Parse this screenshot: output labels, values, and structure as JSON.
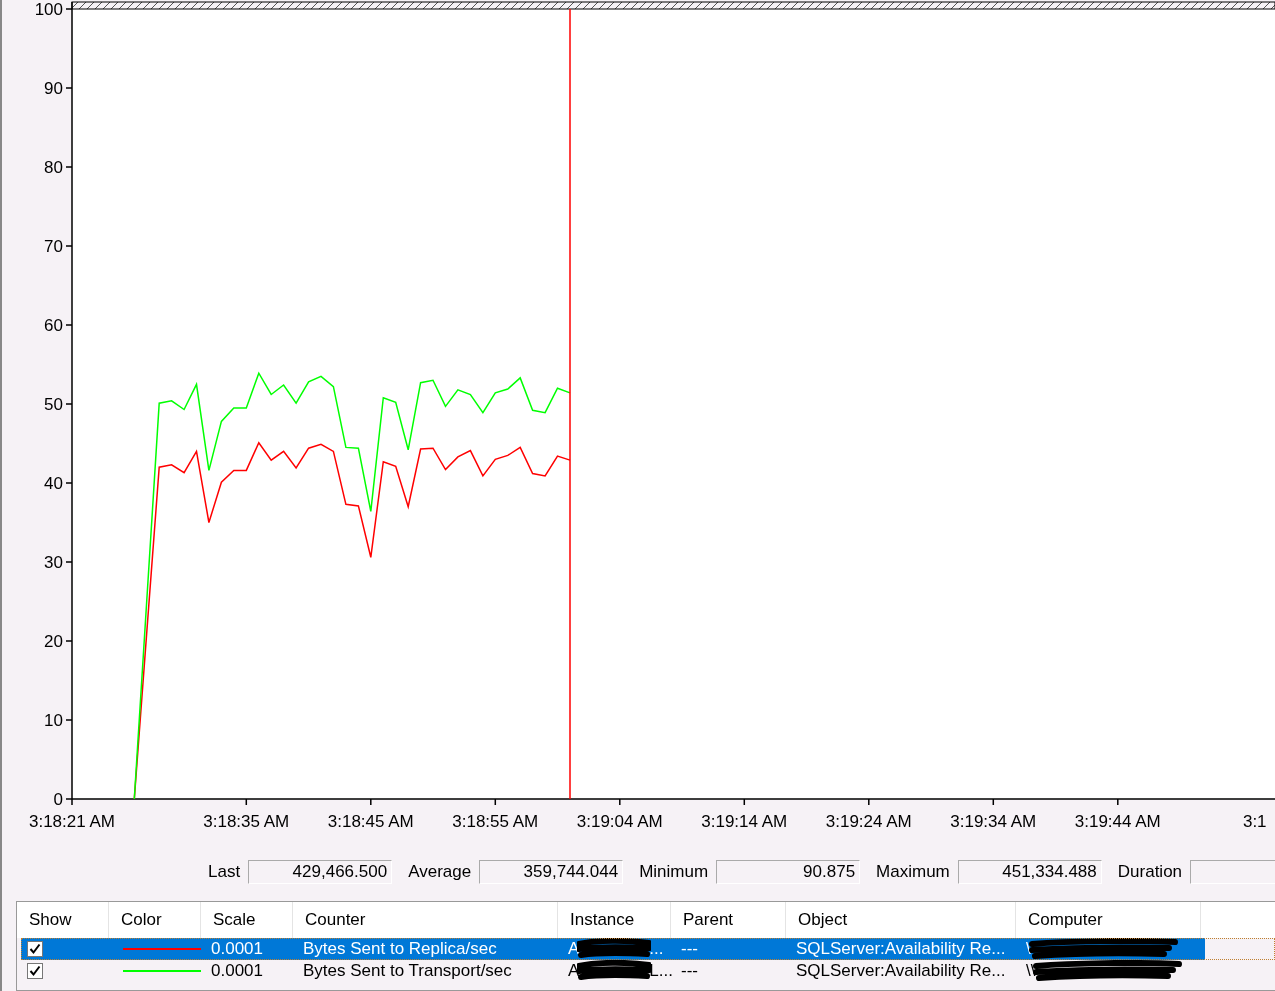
{
  "chart": {
    "chart_data": {
      "type": "line",
      "categories": [
        "3:18:21 AM",
        null,
        null,
        null,
        null,
        null,
        null,
        null,
        null,
        null,
        null,
        null,
        null,
        null,
        "3:18:35 AM",
        null,
        null,
        null,
        null,
        null,
        null,
        null,
        null,
        null,
        "3:18:45 AM",
        null,
        null,
        null,
        null,
        null,
        null,
        null,
        null,
        null,
        "3:18:55 AM",
        null,
        null,
        null,
        null,
        null,
        null,
        null,
        null,
        null,
        "3:19:04 AM",
        null,
        null,
        null,
        null,
        null,
        null,
        null,
        null,
        null,
        "3:19:14 AM",
        null,
        null,
        null,
        null,
        null,
        null,
        null,
        null,
        null,
        "3:19:24 AM",
        null,
        null,
        null,
        null,
        null,
        null,
        null,
        null,
        null,
        "3:19:34 AM",
        null,
        null,
        null,
        null,
        null,
        null,
        null,
        null,
        null,
        "3:19:44 AM",
        null,
        null,
        null,
        null,
        null,
        null,
        null,
        null,
        null,
        null,
        "3:1",
        null,
        null,
        null,
        null
      ],
      "series": [
        {
          "color": "#ff0000",
          "values": [
            null,
            null,
            null,
            null,
            null,
            0,
            21,
            42.0,
            42.3,
            41.3,
            44.0,
            35.0,
            40.1,
            41.6,
            41.6,
            45.1,
            42.9,
            44.0,
            41.9,
            44.4,
            44.9,
            44.0,
            37.3,
            37.1,
            30.6,
            42.7,
            42.1,
            37.0,
            44.3,
            44.4,
            41.7,
            43.3,
            44.1,
            40.9,
            43.0,
            43.5,
            44.5,
            41.2,
            40.9,
            43.4,
            42.9,
            null,
            null,
            null,
            null,
            null,
            null,
            null,
            null,
            null,
            null,
            null,
            null,
            null,
            null,
            null,
            null,
            null,
            null,
            null,
            null,
            null,
            null,
            null,
            null,
            null,
            null,
            null,
            null,
            null,
            null,
            null,
            null,
            null,
            null,
            null,
            null,
            null,
            null,
            null,
            null,
            null,
            null,
            null,
            null,
            null,
            null,
            null,
            null,
            null,
            null,
            null,
            null,
            null,
            null,
            null,
            null,
            null,
            null,
            null
          ]
        },
        {
          "color": "#00ff00",
          "values": [
            null,
            null,
            null,
            null,
            null,
            0,
            25,
            50.1,
            50.4,
            49.3,
            52.5,
            41.6,
            47.8,
            49.5,
            49.5,
            53.9,
            51.2,
            52.4,
            50.1,
            52.8,
            53.5,
            52.2,
            44.5,
            44.4,
            36.4,
            50.8,
            50.2,
            44.2,
            52.7,
            53.0,
            49.7,
            51.8,
            51.2,
            48.9,
            51.4,
            51.9,
            53.3,
            49.2,
            48.9,
            52.0,
            51.4,
            null,
            null,
            null,
            null,
            null,
            null,
            null,
            null,
            null,
            null,
            null,
            null,
            null,
            null,
            null,
            null,
            null,
            null,
            null,
            null,
            null,
            null,
            null,
            null,
            null,
            null,
            null,
            null,
            null,
            null,
            null,
            null,
            null,
            null,
            null,
            null,
            null,
            null,
            null,
            null,
            null,
            null,
            null,
            null,
            null,
            null,
            null,
            null,
            null,
            null,
            null,
            null,
            null,
            null,
            null,
            null,
            null,
            null,
            null
          ]
        }
      ],
      "ylim": [
        0,
        100
      ],
      "yticks": [
        0,
        10,
        20,
        30,
        40,
        50,
        60,
        70,
        80,
        90,
        100
      ]
    }
  },
  "stats": [
    {
      "label": "Last",
      "value": "429,466.500"
    },
    {
      "label": "Average",
      "value": "359,744.044"
    },
    {
      "label": "Minimum",
      "value": "90.875"
    },
    {
      "label": "Maximum",
      "value": "451,334.488"
    },
    {
      "label": "Duration"
    }
  ],
  "table": {
    "columns": [
      "Show",
      "Color",
      "Scale",
      "Counter",
      "Instance",
      "Parent",
      "Object",
      "Computer"
    ],
    "rows": [
      {
        "show": true,
        "selected": true,
        "color": "#ff0000",
        "scale": "0.0001",
        "counter": "Bytes Sent to Replica/sec",
        "instance": "A",
        "instance_end": "...",
        "parent": "---",
        "object": "SQLServer:Availability Re...",
        "computer": "\\"
      },
      {
        "show": true,
        "selected": false,
        "color": "#00ff00",
        "scale": "0.0001",
        "counter": "Bytes Sent to Transport/sec",
        "instance": "A",
        "instance_end": "L...",
        "parent": "---",
        "object": "SQLServer:Availability Re...",
        "computer": "\\\\"
      }
    ]
  }
}
